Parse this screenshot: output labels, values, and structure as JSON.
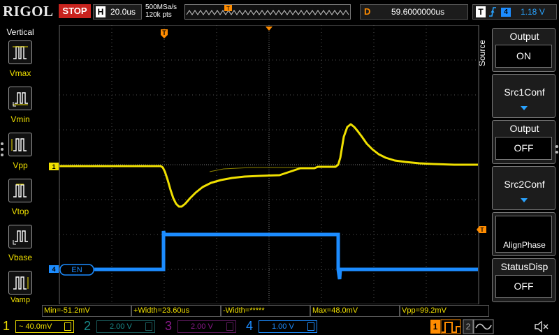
{
  "brand": "RIGOL",
  "run_status": "STOP",
  "horizontal": {
    "key": "H",
    "timebase": "20.0us"
  },
  "acquisition": {
    "sample_rate": "500MSa/s",
    "memory_depth": "120k pts"
  },
  "trigger_marker": "T",
  "delay": {
    "key": "D",
    "value": "59.6000000us"
  },
  "trigger": {
    "key": "T",
    "source": "4",
    "level": "1.18 V",
    "edge_icon": "rising-edge-icon"
  },
  "vertical_menu": {
    "title": "Vertical",
    "items": [
      {
        "label": "Vmax",
        "icon": "vmax-icon"
      },
      {
        "label": "Vmin",
        "icon": "vmin-icon"
      },
      {
        "label": "Vpp",
        "icon": "vpp-icon"
      },
      {
        "label": "Vtop",
        "icon": "vtop-icon"
      },
      {
        "label": "Vbase",
        "icon": "vbase-icon"
      },
      {
        "label": "Vamp",
        "icon": "vamp-icon"
      }
    ]
  },
  "right_menu": {
    "tab": "Source",
    "items": [
      {
        "label": "Output",
        "value": "ON"
      },
      {
        "label": "Src1Conf"
      },
      {
        "label": "Output",
        "value": "OFF"
      },
      {
        "label": "Src2Conf"
      },
      {
        "label": "AlignPhase"
      },
      {
        "label": "StatusDisp",
        "value": "OFF"
      }
    ]
  },
  "measurements": [
    "Min=-51.2mV",
    "+Width=23.60us",
    "-Width=*****",
    "Max=48.0mV",
    "Vpp=99.2mV"
  ],
  "channels": [
    {
      "num": "1",
      "coupling": "~",
      "scale": "40.0mV",
      "color": "#f0e000",
      "active": true
    },
    {
      "num": "2",
      "scale": "2.00 V",
      "color": "#1a8c8c",
      "active": false
    },
    {
      "num": "3",
      "scale": "2.00 V",
      "color": "#8c1a8c",
      "active": false
    },
    {
      "num": "4",
      "scale": "1.00 V",
      "color": "#1c8cff",
      "active": true
    }
  ],
  "trace_labels": {
    "ch1": "1",
    "ch4": "4",
    "ch4_name": "EN",
    "right_marker": "T"
  },
  "colors": {
    "ch1": "#f0e000",
    "ch4": "#1c8cff",
    "trigger": "#ff8c00",
    "stop": "#c8231e"
  }
}
